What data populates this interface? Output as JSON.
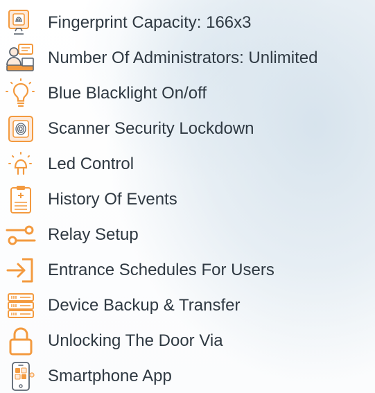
{
  "accent_color": "#f39a3f",
  "features": [
    {
      "label": "Fingerprint Capacity: 166x3",
      "icon": "fingerprint-scanner-icon"
    },
    {
      "label": "Number Of Administrators: Unlimited",
      "icon": "administrators-icon"
    },
    {
      "label": "Blue Blacklight On/off",
      "icon": "light-bulb-icon"
    },
    {
      "label": "Scanner Security Lockdown",
      "icon": "scanner-lock-icon"
    },
    {
      "label": "Led Control",
      "icon": "led-lamp-icon"
    },
    {
      "label": "History Of Events",
      "icon": "clipboard-history-icon"
    },
    {
      "label": "Relay Setup",
      "icon": "relay-switch-icon"
    },
    {
      "label": "Entrance Schedules For Users",
      "icon": "entrance-arrow-icon"
    },
    {
      "label": "Device Backup & Transfer",
      "icon": "server-backup-icon"
    },
    {
      "label": "Unlocking The Door Via",
      "icon": "padlock-icon"
    },
    {
      "label": "Smartphone App",
      "icon": "smartphone-app-icon"
    }
  ]
}
